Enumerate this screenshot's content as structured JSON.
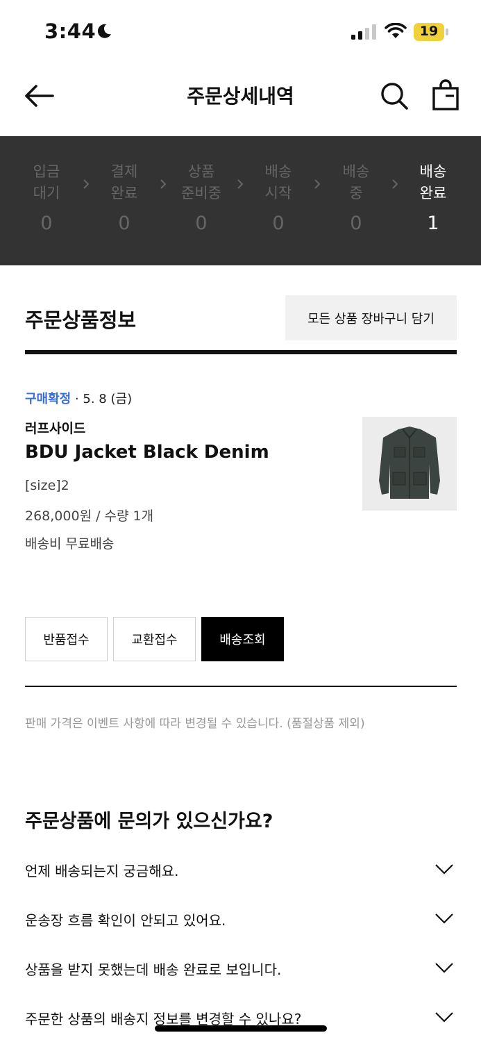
{
  "status_bar": {
    "time": "3:44",
    "battery": "19"
  },
  "header": {
    "title": "주문상세내역"
  },
  "progress": {
    "steps": [
      {
        "label": "입금\n대기",
        "count": "0"
      },
      {
        "label": "결제\n완료",
        "count": "0"
      },
      {
        "label": "상품\n준비중",
        "count": "0"
      },
      {
        "label": "배송\n시작",
        "count": "0"
      },
      {
        "label": "배송\n중",
        "count": "0"
      },
      {
        "label": "배송\n완료",
        "count": "1"
      }
    ],
    "active_index": 5
  },
  "order": {
    "section_title": "주문상품정보",
    "cart_all_label": "모든 상품 장바구니 담기",
    "status": "구매확정",
    "date": " · 5. 8 (금)",
    "brand": "러프사이드",
    "product_name": "BDU Jacket Black Denim",
    "option": "[size]2",
    "price_qty": "268,000원 / 수량 1개",
    "shipping": "배송비 무료배송",
    "actions": {
      "return": "반품접수",
      "exchange": "교환접수",
      "tracking": "배송조회"
    },
    "notice": "판매 가격은 이벤트 사항에 따라 변경될 수 있습니다. (품절상품 제외)"
  },
  "faq": {
    "title": "주문상품에 문의가 있으신가요?",
    "items": [
      "언제 배송되는지 궁금해요.",
      "운송장 흐름 확인이 안되고 있어요.",
      "상품을 받지 못했는데 배송 완료로 보입니다.",
      "주문한 상품의 배송지 정보를 변경할 수 있나요?"
    ]
  },
  "colors": {
    "accent_blue": "#3a6fd8",
    "progress_bg": "#333333",
    "battery": "#f0d13a"
  },
  "icons": [
    "moon-icon",
    "signal-icon",
    "wifi-icon",
    "battery-icon",
    "back-arrow-icon",
    "search-icon",
    "shopping-bag-icon",
    "chevron-right-icon",
    "chevron-down-icon"
  ]
}
